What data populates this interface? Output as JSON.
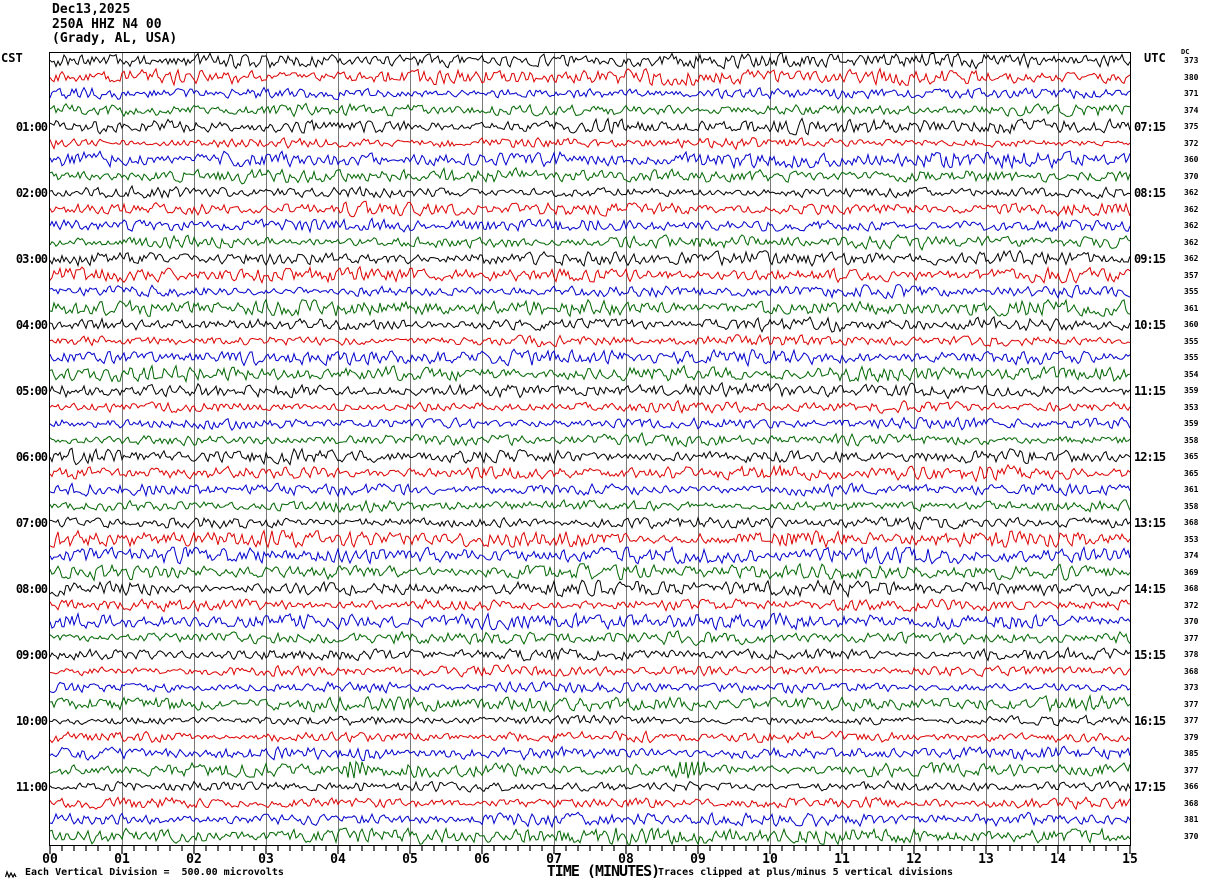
{
  "header": {
    "date": "Dec13,2025",
    "station": "250A HHZ N4 00",
    "location": "(Grady, AL, USA)"
  },
  "axes": {
    "left_tz": "CST",
    "right_tz": "UTC",
    "dc_label": "DC",
    "xlabel": "TIME (MINUTES)",
    "left_times": [
      "01:00",
      "02:00",
      "03:00",
      "04:00",
      "05:00",
      "06:00",
      "07:00",
      "08:00",
      "09:00",
      "10:00",
      "11:00"
    ],
    "right_times": [
      "07:15",
      "08:15",
      "09:15",
      "10:15",
      "11:15",
      "12:15",
      "13:15",
      "14:15",
      "15:15",
      "16:15",
      "17:15"
    ],
    "minutes": [
      "00",
      "01",
      "02",
      "03",
      "04",
      "05",
      "06",
      "07",
      "08",
      "09",
      "10",
      "11",
      "12",
      "13",
      "14",
      "15"
    ]
  },
  "dc_values": [
    373,
    380,
    371,
    374,
    375,
    372,
    360,
    370,
    362,
    362,
    362,
    362,
    362,
    357,
    355,
    361,
    360,
    355,
    355,
    354,
    359,
    353,
    359,
    358,
    365,
    365,
    361,
    358,
    368,
    353,
    374,
    369,
    368,
    372,
    370,
    377,
    378,
    368,
    373,
    377,
    377,
    379,
    385,
    377,
    366,
    368,
    381,
    370
  ],
  "footer": {
    "left": "Each Vertical Division =  500.00 microvolts",
    "right": "Traces clipped at plus/minus 5 vertical divisions"
  },
  "colors": {
    "trace_cycle": [
      "#000000",
      "#dd0000",
      "#0000cc",
      "#006600"
    ],
    "grid": "#777777",
    "border": "#000000",
    "background": "#ffffff"
  },
  "chart_data": {
    "type": "line",
    "kind": "helicorder-seismogram",
    "title": "Dec13,2025 250A HHZ N4 00 (Grady, AL, USA)",
    "xlabel": "TIME (MINUTES)",
    "x_min_minutes": 0,
    "x_max_minutes": 15,
    "minutes_per_line": 15,
    "lines_per_hour": 4,
    "num_lines": 48,
    "grid": "vertical line every 1 minute",
    "x_minor_tick_seconds": 10,
    "cst_hour_labels": [
      "01:00",
      "02:00",
      "03:00",
      "04:00",
      "05:00",
      "06:00",
      "07:00",
      "08:00",
      "09:00",
      "10:00",
      "11:00"
    ],
    "utc_hour_labels": [
      "07:15",
      "08:15",
      "09:15",
      "10:15",
      "11:15",
      "12:15",
      "13:15",
      "14:15",
      "15:15",
      "16:15",
      "17:15"
    ],
    "dc_offset_per_line": [
      373,
      380,
      371,
      374,
      375,
      372,
      360,
      370,
      362,
      362,
      362,
      362,
      362,
      357,
      355,
      361,
      360,
      355,
      355,
      354,
      359,
      353,
      359,
      358,
      365,
      365,
      361,
      358,
      368,
      353,
      374,
      369,
      368,
      372,
      370,
      377,
      378,
      368,
      373,
      377,
      377,
      379,
      385,
      377,
      366,
      368,
      381,
      370
    ],
    "line_color_cycle": [
      "black",
      "red",
      "blue",
      "green"
    ],
    "content": "continuous background seismic noise on all 48 lines",
    "events": [
      {
        "line_index": 43,
        "minute": 4.25,
        "color": "green",
        "note": "short high-amplitude burst"
      },
      {
        "line_index": 43,
        "minute": 8.9,
        "color": "green",
        "note": "short high-amplitude burst"
      }
    ],
    "amplitude_scale": "Each Vertical Division = 500.00 microvolts",
    "clipping": "Traces clipped at plus/minus 5 vertical divisions"
  }
}
